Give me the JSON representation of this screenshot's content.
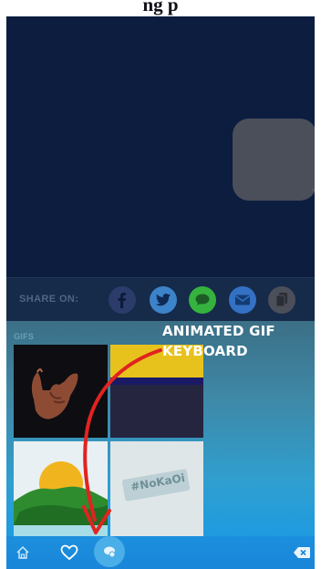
{
  "header": {
    "glyphs": "ng p"
  },
  "share": {
    "label": "SHARE ON:",
    "buttons": [
      {
        "name": "facebook",
        "color": "#2b3b6a"
      },
      {
        "name": "twitter",
        "color": "#3d83c9"
      },
      {
        "name": "messages",
        "color": "#35b33e"
      },
      {
        "name": "email",
        "color": "#3471c5"
      },
      {
        "name": "copy",
        "color": "#4b4f5a"
      }
    ]
  },
  "gifs": {
    "label": "GIFS",
    "tile_4_text": "#NoKaOi"
  },
  "annotation": {
    "line1": "ANIMATED GIF",
    "line2": "KEYBOARD",
    "arrow_color": "#e0241f"
  },
  "bottom_bar": {
    "items": [
      "home-icon",
      "heart-icon",
      "gif-keyboard-icon",
      "backspace-icon"
    ]
  }
}
